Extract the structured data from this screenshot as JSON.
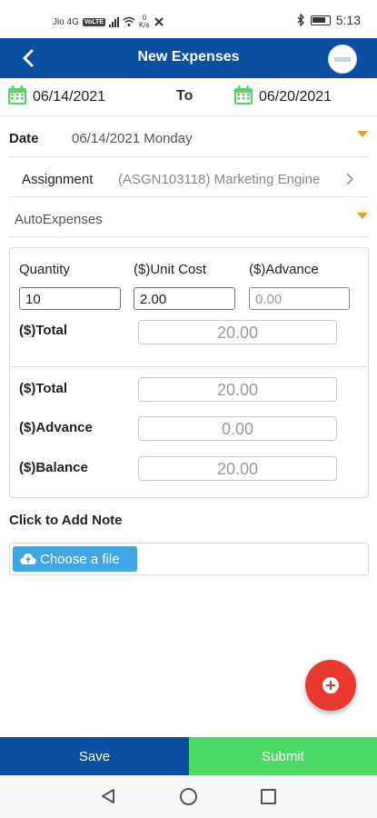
{
  "status_bar": {
    "carrier": "Jio 4G",
    "volte": "VoLTE",
    "speed": "0\nK/s",
    "time": "5:13"
  },
  "header": {
    "title": "New Expenses",
    "back_icon": "chevron-left-icon",
    "logo_icon": "company-logo"
  },
  "date_range": {
    "from": "06/14/2021",
    "to_label": "To",
    "to": "06/20/2021",
    "calendar_icon": "calendar-icon",
    "calendar_color": "#4cd964"
  },
  "form": {
    "date_label": "Date",
    "date_value": "06/14/2021 Monday",
    "assignment_label": "Assignment",
    "assignment_value": "(ASGN103118) Marketing Engine",
    "expense_type": "AutoExpenses"
  },
  "line_item": {
    "quantity_label": "Quantity",
    "unit_cost_label": "($)Unit Cost",
    "advance_label": "($)Advance",
    "quantity_value": "10",
    "unit_cost_value": "2.00",
    "advance_placeholder": "0.00",
    "total_label": "($)Total",
    "total_value": "20.00"
  },
  "summary": {
    "total_label": "($)Total",
    "total_value": "20.00",
    "advance_label": "($)Advance",
    "advance_value": "0.00",
    "balance_label": "($)Balance",
    "balance_value": "20.00"
  },
  "note": {
    "label": "Click to Add Note",
    "file_button": "Choose a file",
    "file_icon": "cloud-upload-icon"
  },
  "actions": {
    "save": "Save",
    "submit": "Submit",
    "fab_icon": "add-circle-icon"
  },
  "colors": {
    "primary": "#0a4fa1",
    "success": "#4cd964",
    "accent": "#f39c12",
    "fab": "#e9392e",
    "file_button": "#3fa7e6"
  }
}
